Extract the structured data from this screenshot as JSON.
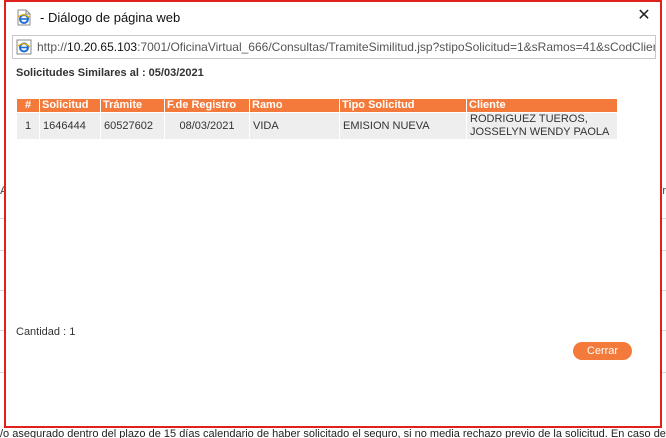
{
  "window": {
    "title": "- Diálogo de página web",
    "close_glyph": "✕"
  },
  "address": {
    "prefix": "http://",
    "host": "10.20.65.103",
    "rest": ":7001/OficinaVirtual_666/Consultas/TramiteSimilitud.jsp?stipoSolicitud=1&sRamos=41&sCodClien"
  },
  "background_page": {
    "left_edge": "A",
    "right_edge": "r",
    "bottom_text": "/o asegurado dentro del plazo de 15 días calendario de haber solicitado el seguro, si no media rechazo previo de la solicitud. En caso de"
  },
  "content": {
    "heading": "Solicitudes Similares al : 05/03/2021",
    "table": {
      "headers": [
        "#",
        "Solicitud",
        "Trámite",
        "F.de Registro",
        "Ramo",
        "Tipo Solicitud",
        "Cliente"
      ],
      "rows": [
        {
          "num": "1",
          "solicitud": "1646444",
          "tramite": "60527602",
          "fecha": "08/03/2021",
          "ramo": "VIDA",
          "tipo": "EMISION NUEVA",
          "cliente_line1": "RODRIGUEZ TUEROS,",
          "cliente_line2": "JOSSELYN WENDY PAOLA"
        }
      ]
    },
    "cantidad": "Cantidad : 1",
    "close_button": "Cerrar"
  },
  "colors": {
    "accent": "#f47a3c",
    "dialog_border": "#e0201c"
  },
  "icons": {
    "title_icon": "ie-page-icon",
    "address_icon": "ie-page-icon"
  }
}
